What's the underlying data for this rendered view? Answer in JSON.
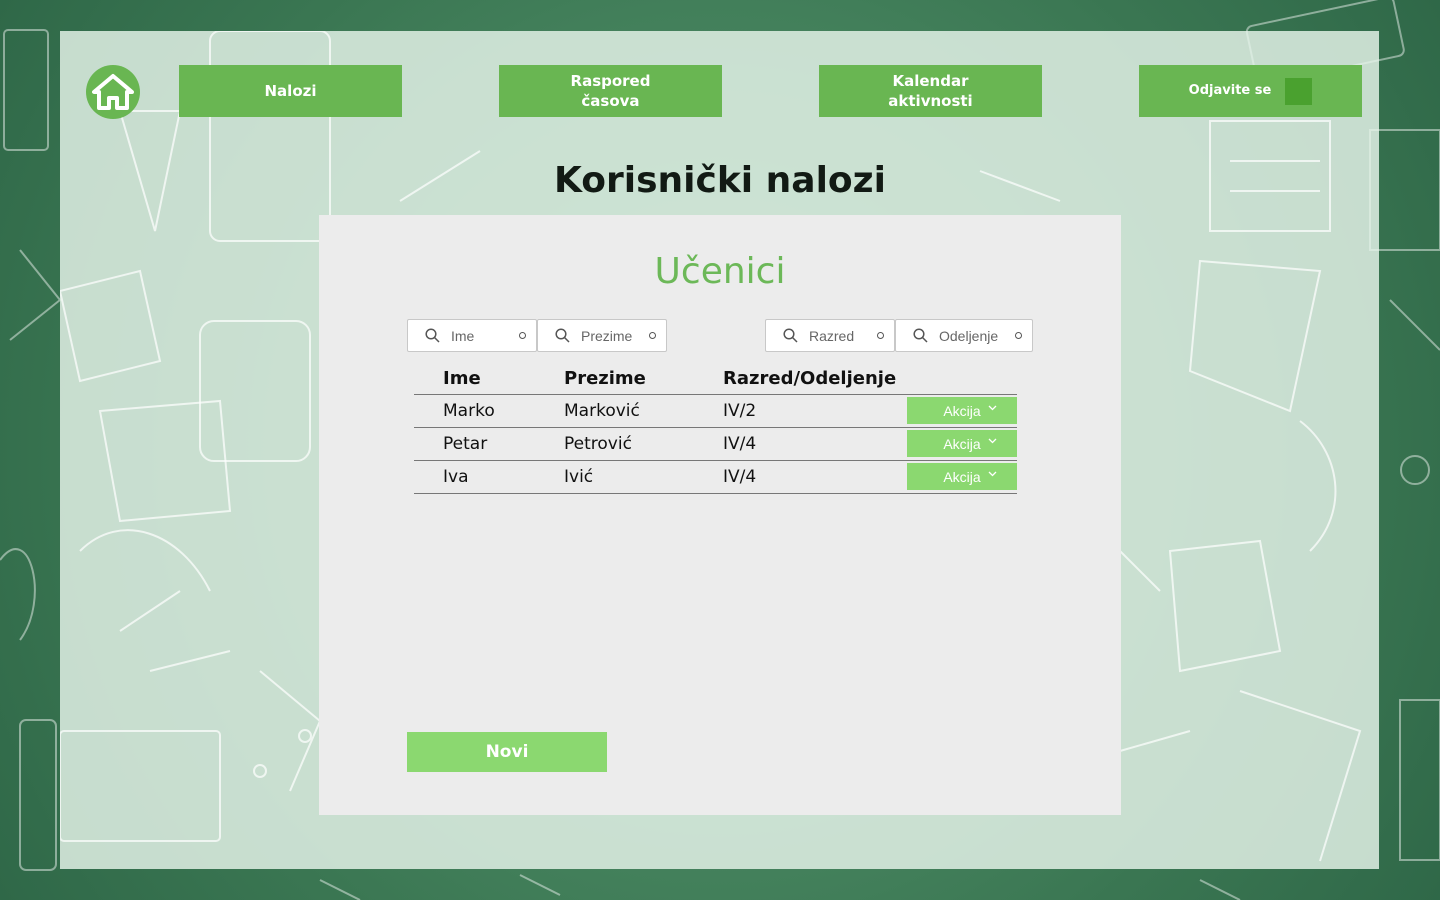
{
  "nav": {
    "home_icon": "home-icon",
    "items": [
      {
        "label_line1": "Nalozi",
        "label_line2": ""
      },
      {
        "label_line1": "Raspored",
        "label_line2": "časova"
      },
      {
        "label_line1": "Kalendar",
        "label_line2": "aktivnosti"
      }
    ],
    "logout_label": "Odjavite se"
  },
  "page_title": "Korisnički nalozi",
  "section_title": "Učenici",
  "filters": [
    {
      "placeholder": "Ime"
    },
    {
      "placeholder": "Prezime"
    },
    {
      "placeholder": "Razred"
    },
    {
      "placeholder": "Odeljenje"
    }
  ],
  "table": {
    "headers": [
      "Ime",
      "Prezime",
      "Razred/Odeljenje"
    ],
    "rows": [
      {
        "ime": "Marko",
        "prezime": "Marković",
        "razred": "IV/2",
        "action": "Akcija"
      },
      {
        "ime": "Petar",
        "prezime": "Petrović",
        "razred": "IV/4",
        "action": "Akcija"
      },
      {
        "ime": "Iva",
        "prezime": "Ivić",
        "razred": "IV/4",
        "action": "Akcija"
      }
    ]
  },
  "new_button": "Novi",
  "colors": {
    "accent": "#69b652",
    "action": "#8bd870",
    "title_green": "#6cb858",
    "background": "#3d7a58"
  }
}
